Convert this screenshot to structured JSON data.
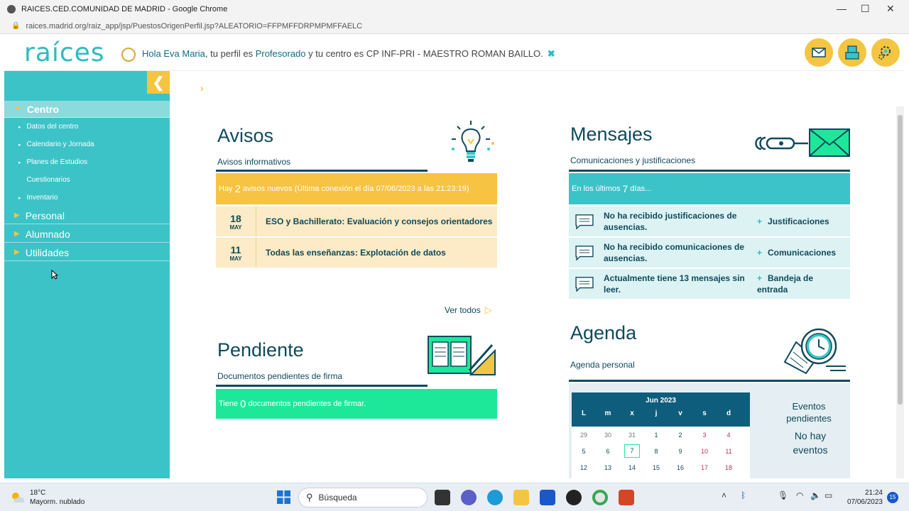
{
  "browser": {
    "window_title": "RAICES.CED.COMUNIDAD DE MADRID - Google Chrome",
    "url": "raices.madrid.org/raiz_app/jsp/PuestosOrigenPerfil.jsp?ALEATORIO=FFPMFFDRPMPMFFAELC"
  },
  "header": {
    "logo": "raíces",
    "greeting_prefix": "Hola Eva Maria",
    "greeting_mid": ", tu perfil es ",
    "profile": "Profesorado",
    "greeting_center": " y tu centro es CP INF-PRI - MAESTRO ROMAN BAILLO.",
    "close_icon": "✖"
  },
  "sidebar": {
    "collapse_label": "❮",
    "categories": [
      {
        "label": "Centro"
      },
      {
        "label": "Personal"
      },
      {
        "label": "Alumnado"
      },
      {
        "label": "Utilidades"
      }
    ],
    "centro_items": [
      {
        "label": "Datos del centro"
      },
      {
        "label": "Calendario y Jornada"
      },
      {
        "label": "Planes de Estudios"
      },
      {
        "label": "Cuestionarios"
      },
      {
        "label": "Inventario"
      }
    ]
  },
  "avisos": {
    "title": "Avisos",
    "subtitle": "Avisos informativos",
    "banner_pre": "Hay",
    "banner_count": "2",
    "banner_post": "avisos nuevos (Última conexión el día 07/06/2023 a las 21:23:19)",
    "items": [
      {
        "day": "18",
        "month": "MAY",
        "text": "ESO y Bachillerato: Evaluación y consejos orientadores"
      },
      {
        "day": "11",
        "month": "MAY",
        "text": "Todas las enseñanzas: Explotación de datos"
      }
    ],
    "ver_todos": "Ver todos"
  },
  "pendiente": {
    "title": "Pendiente",
    "subtitle": "Documentos pendientes de firma",
    "banner_pre": "Tiene",
    "banner_count": "0",
    "banner_post": "documentos pendientes de firmar."
  },
  "mensajes": {
    "title": "Mensajes",
    "subtitle": "Comunicaciones y justificaciones",
    "banner_pre": "En los últimos",
    "banner_count": "7",
    "banner_post": "días...",
    "rows": [
      {
        "text": "No ha recibido justificaciones de ausencias.",
        "link": "Justificaciones"
      },
      {
        "text": "No ha recibido comunicaciones de ausencias.",
        "link": "Comunicaciones"
      },
      {
        "text": "Actualmente tiene 13 mensajes sin leer.",
        "link": "Bandeja de entrada"
      }
    ],
    "plus": "+"
  },
  "agenda": {
    "title": "Agenda",
    "subtitle": "Agenda personal",
    "calendar": {
      "month": "Jun 2023",
      "weekdays": [
        "L",
        "m",
        "x",
        "j",
        "v",
        "s",
        "d"
      ],
      "weeks": [
        [
          "29",
          "30",
          "31",
          "1",
          "2",
          "3",
          "4"
        ],
        [
          "5",
          "6",
          "7",
          "8",
          "9",
          "10",
          "11"
        ],
        [
          "12",
          "13",
          "14",
          "15",
          "16",
          "17",
          "18"
        ]
      ],
      "today": "7"
    },
    "events_title": "Eventos pendientes",
    "events_none": "No hay eventos"
  },
  "taskbar": {
    "temperature": "18°C",
    "weather": "Mayorm. nublado",
    "search_placeholder": "Búsqueda",
    "time": "21:24",
    "date": "07/06/2023",
    "notifications": "15"
  },
  "colors": {
    "teal": "#3cc3c7",
    "dark_teal": "#0f4a5c",
    "yellow": "#f4c542",
    "green": "#1de89a"
  }
}
